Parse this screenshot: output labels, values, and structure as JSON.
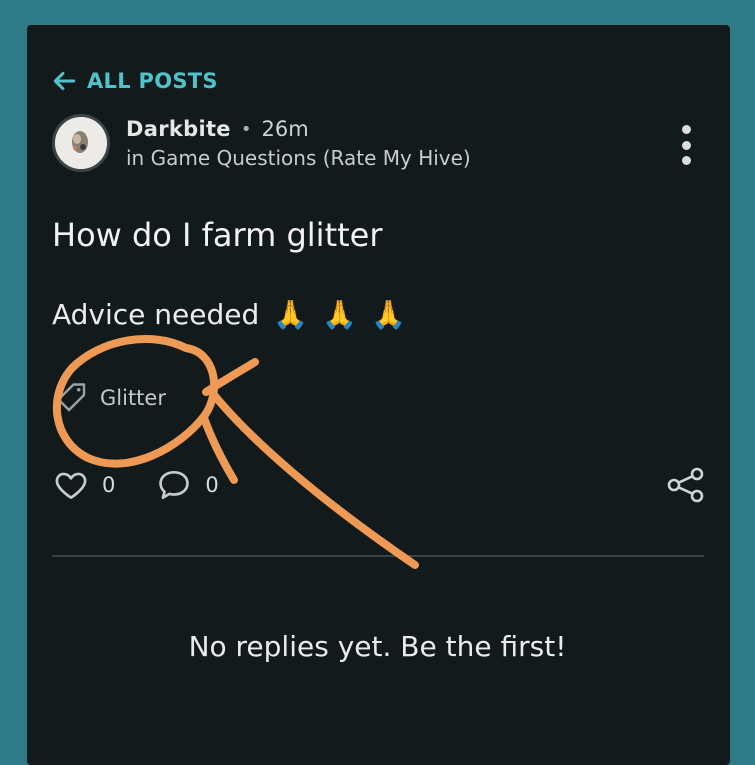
{
  "nav": {
    "back_label": "ALL POSTS"
  },
  "post": {
    "author": "Darkbite",
    "time": "26m",
    "community": "in Game Questions (Rate My Hive)",
    "title": "How do I farm glitter",
    "body_text": "Advice needed",
    "body_emoji": [
      "🙏",
      "🙏",
      "🙏"
    ],
    "tag": "Glitter",
    "likes": "0",
    "comments": "0"
  },
  "replies": {
    "empty_text": "No replies yet. Be the first!"
  },
  "icons": [
    "arrow-left-icon",
    "kebab-menu-icon",
    "tag-icon",
    "heart-icon",
    "comment-icon",
    "share-icon"
  ],
  "colors": {
    "accent": "#4fc3c9",
    "background": "#2e7a86",
    "panel": "#121a1c",
    "annotation": "#ee9a55"
  }
}
